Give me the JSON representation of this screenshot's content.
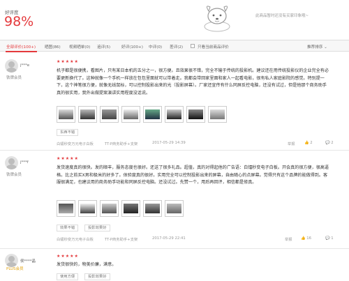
{
  "summary": {
    "good_rate_label": "好评度",
    "good_rate_value": "98%",
    "empty_text": "此商品暂时还没有买家印象哦~"
  },
  "filters": {
    "tabs": [
      {
        "label": "全部评价(100+)"
      },
      {
        "label": "晒图(86)"
      },
      {
        "label": "视频晒单(0)"
      },
      {
        "label": "追评(5)"
      },
      {
        "label": "好评(100+)"
      },
      {
        "label": "中评(0)"
      },
      {
        "label": "差评(2)"
      }
    ],
    "only_current_label": "只看当前商品评价",
    "sort_label": "推荐排序",
    "sort_icon": "chevron-down-icon"
  },
  "colors": {
    "accent": "#e4393c",
    "plus": "#e3a30e"
  },
  "reviews": [
    {
      "username": "j***e",
      "level": "铁牌会员",
      "stars": "★★★★★",
      "content": "机子都是很便携，看图片，只有某日本机的五分之一，很方便。且效果很不错，完全不输于传统的投影机。建议还在用传统投影仪的企业完全有必要更新换代了。这种就像一个手机一样放在包包里面就可以带着走。我都会带回家里面和家人一起看电影，很有私人家庭影院的感觉。特别提一下，这个神笔很方便，就像无线鼠标，可以控制投影出来的光（投影屏幕）。厂家还宣传有什么同屏反控电脑，还没有试过，但是他那个商务助手真的很实用，我外出做提案演讲实用程度没话说。",
      "photo_count": 8,
      "tags": [
        "东西不错"
      ],
      "product": "白镭秒变万元电子白板",
      "spec": "TT-P商务助手+支架",
      "date": "2017-05-29 14:39",
      "report": "举报",
      "likes": "2",
      "comments": "2"
    },
    {
      "username": "j***f",
      "level": "铁牌会员",
      "stars": "★★★★★",
      "content": "发货速度真的很快。发的顺丰，服务态度也很好。还送了很多礼品。超值，真的对得起他的广告语：白镭秒变电子白板。开会真的很方便，很高逼格。比之前买X男和极米的好多了。体验度真的很好。实用完全可以控制投影出来的屏幕，自由随心的点屏幕。觉得只有这个品牌的能做得到。客服很满足，也建议用的商务助手功能和同屏反控电脑。还没试过。先赞一个，用后再回评，相信都是修真。",
      "photo_count": 6,
      "tags": [
        "效果不错",
        "投影效果好"
      ],
      "product": "白镭秒变万元电子白板",
      "spec": "TT-P商务助手+支架",
      "date": "2017-05-29 22:41",
      "report": "举报",
      "likes": "16",
      "comments": "1"
    },
    {
      "username": "侯****晶",
      "level": "PLUS会员",
      "stars": "★★★★★",
      "content": "发货很快的，物美价廉，满意。",
      "tags": [
        "使用方便",
        "投影效果好"
      ]
    }
  ]
}
